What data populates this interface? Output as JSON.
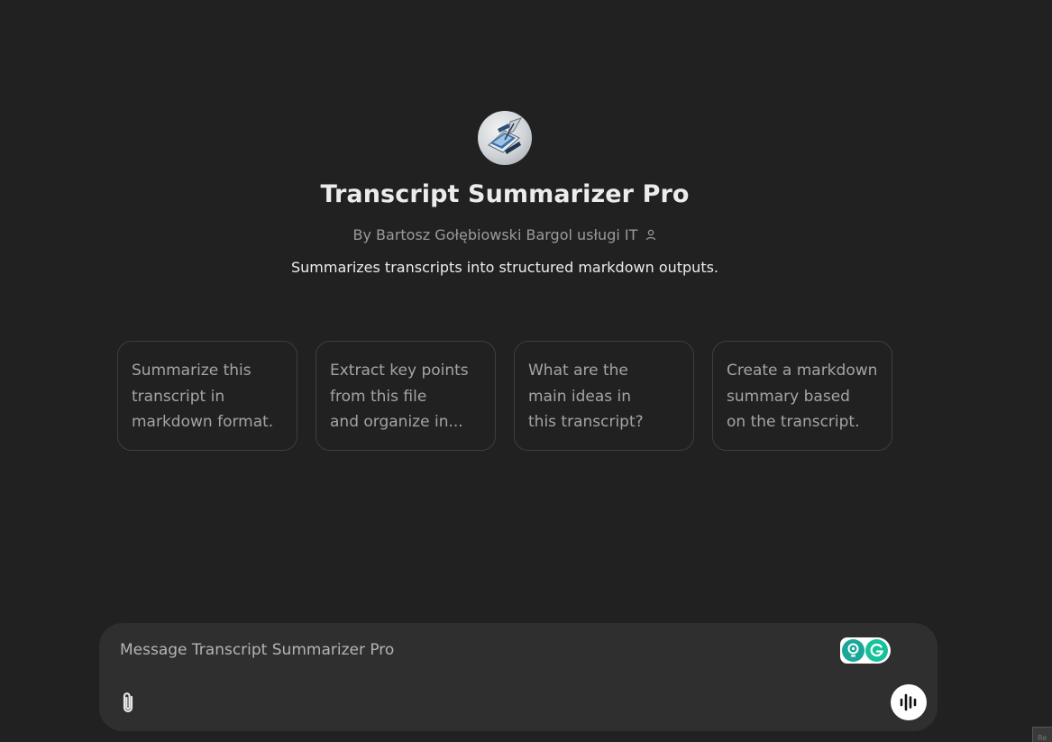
{
  "gpt": {
    "title": "Transcript Summarizer Pro",
    "author": "By Bartosz Gołębiowski Bargol usługi IT",
    "description": "Summarizes transcripts into structured markdown outputs.",
    "avatar_icon": "document-quill-logo-icon"
  },
  "starters": [
    {
      "lines": [
        "Summarize this",
        "transcript in",
        "markdown format."
      ]
    },
    {
      "lines": [
        "Extract key points",
        "from this file",
        "and organize in..."
      ]
    },
    {
      "lines": [
        "What are the",
        "main ideas in",
        "this transcript?"
      ]
    },
    {
      "lines": [
        "Create a markdown",
        "summary based",
        "on the transcript."
      ]
    }
  ],
  "composer": {
    "placeholder": "Message Transcript Summarizer Pro",
    "attach_icon": "paperclip-icon",
    "voice_icon": "voice-mode-icon",
    "extension_icon": "grammarly-icon"
  },
  "corner_tag": "Re",
  "colors": {
    "background": "#212121",
    "composer": "#2f2f2f",
    "card_border": "#3e3e3e",
    "grammarly": "#15c39a"
  }
}
